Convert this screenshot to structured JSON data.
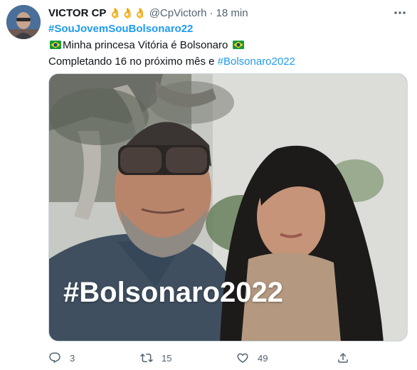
{
  "tweet": {
    "author_name": "VICTOR CP",
    "name_emoji": "👌👌👌",
    "handle": "@CpVictorh",
    "separator": "·",
    "time": "18 min",
    "hashtag_line": "#SouJovemSouBolsonaro22",
    "line2_text": "Minha princesa Vitória é Bolsonaro",
    "line3_text": "Completando 16 no próximo mês e ",
    "line3_hashtag": "#Bolsonaro2022",
    "image_overlay_text": "#Bolsonaro2022"
  },
  "actions": {
    "replies": "3",
    "retweets": "15",
    "likes": "49"
  },
  "icons": {
    "more": "more-icon",
    "reply": "reply-icon",
    "retweet": "retweet-icon",
    "like": "heart-icon",
    "share": "share-icon",
    "flag": "brazil-flag-icon"
  },
  "colors": {
    "link": "#1d9bf0",
    "secondary": "#536471",
    "text": "#0f1419"
  }
}
